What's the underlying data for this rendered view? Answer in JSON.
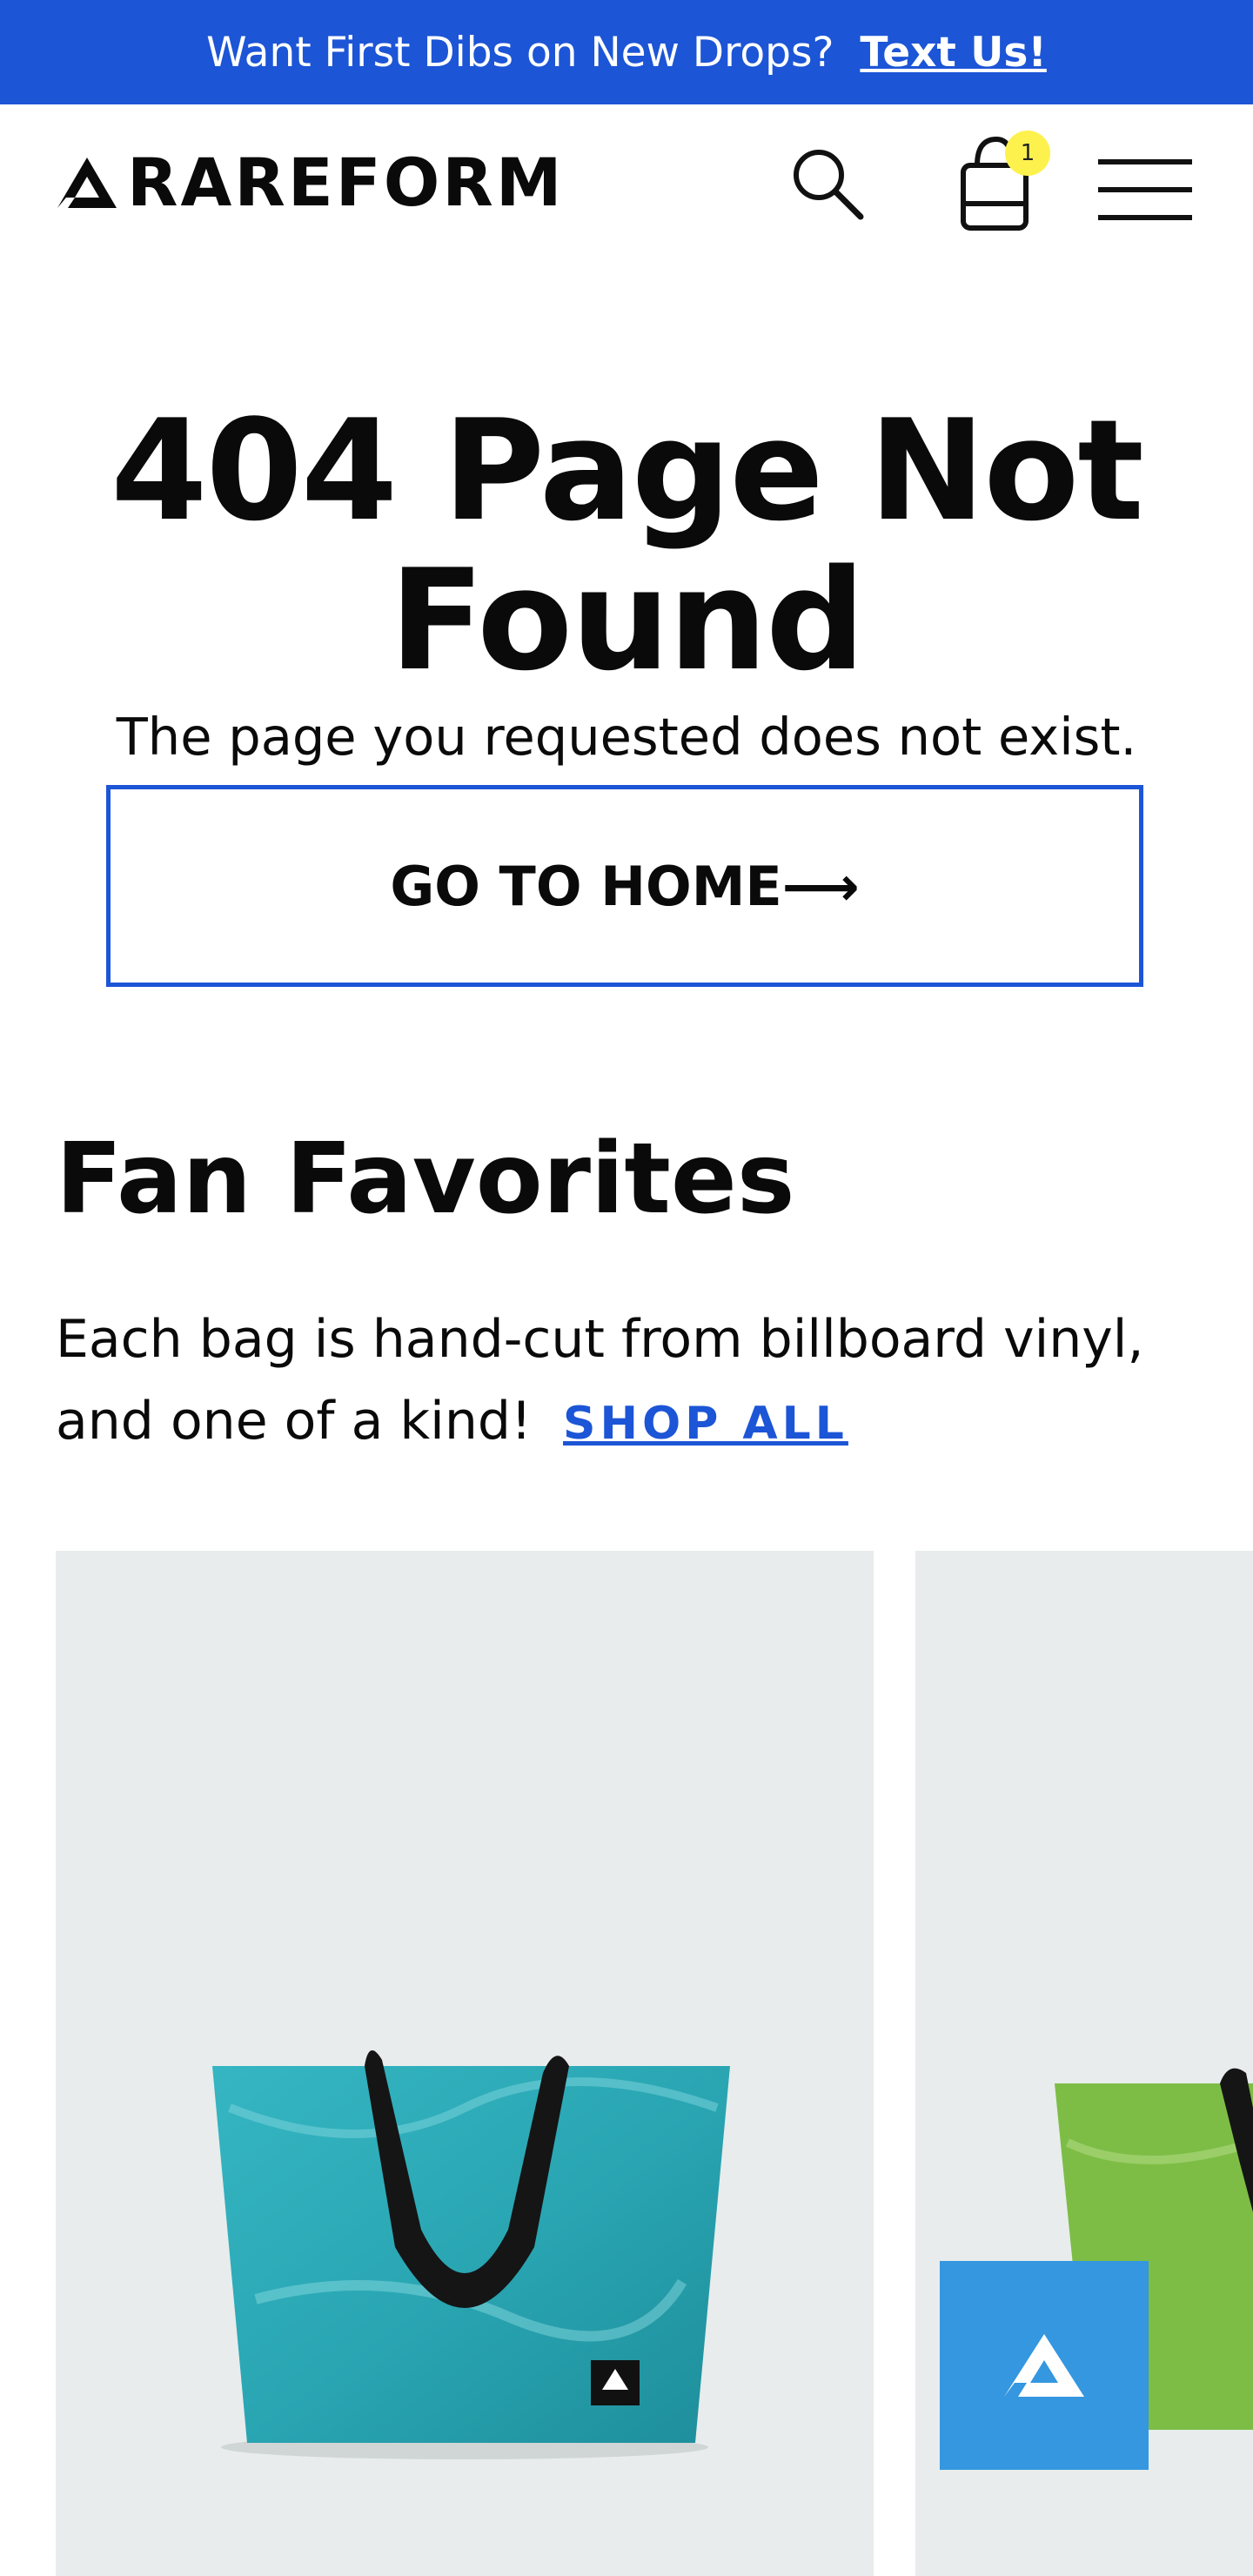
{
  "announcement": {
    "text": "Want First Dibs on New Drops?",
    "link": "Text Us!"
  },
  "header": {
    "logo_text": "RAREFORM",
    "cart_count": "1",
    "icons": {
      "search": "search-icon",
      "cart": "shopping-bag-icon",
      "menu": "hamburger-menu-icon"
    }
  },
  "error": {
    "title": "404 Page Not Found",
    "message": "The page you requested does not exist.",
    "button_label": "GO TO HOME⟶"
  },
  "favorites": {
    "title": "Fan Favorites",
    "description": "Each bag is hand-cut from billboard vinyl, and one of a kind!",
    "shop_all": "SHOP ALL",
    "products": [
      {
        "image": "teal-tote-bag",
        "color": "#2aa6b3"
      },
      {
        "image": "green-tote-bag",
        "color": "#7dbd45"
      }
    ]
  },
  "chat_widget": {
    "icon": "rareform-logo-icon",
    "color": "#3497e0"
  },
  "colors": {
    "accent": "#1c55d6",
    "badge": "#fdf24d",
    "card_background": "#e8ecec"
  }
}
